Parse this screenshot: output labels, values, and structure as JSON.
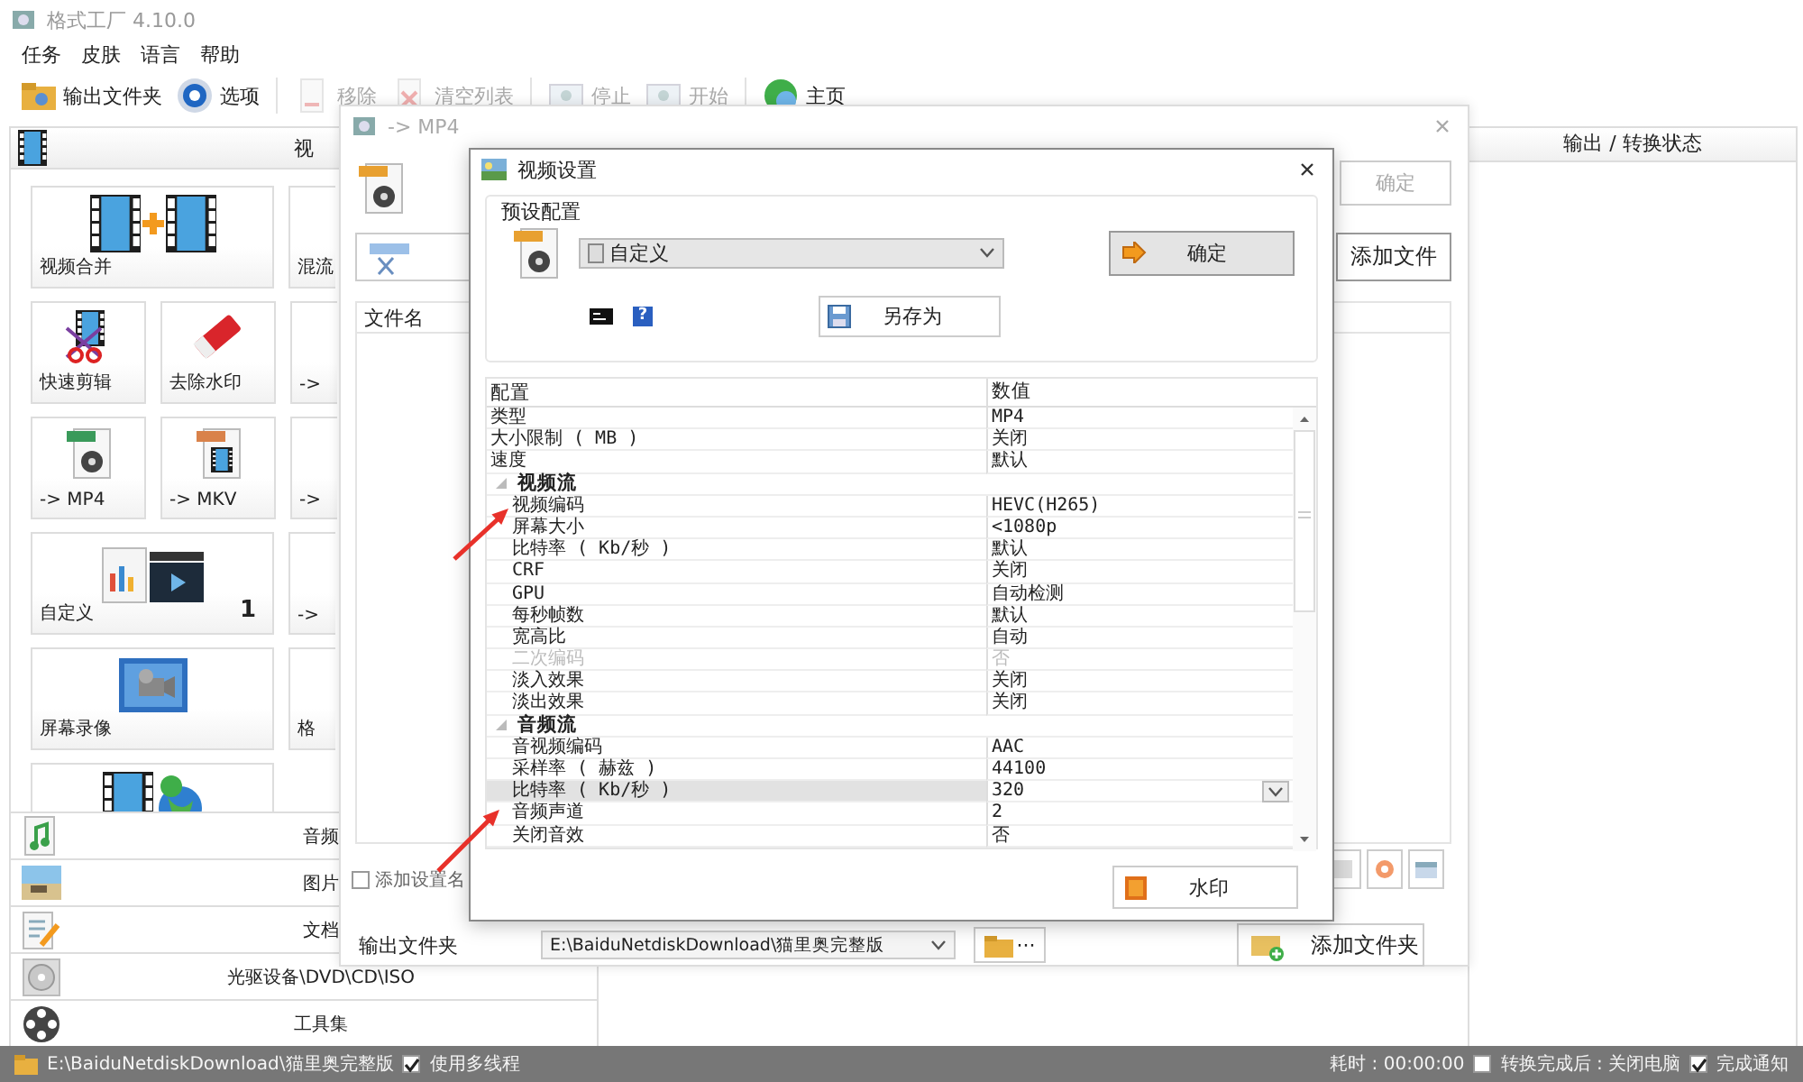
{
  "window": {
    "title": "格式工厂 4.10.0"
  },
  "menu": [
    "任务",
    "皮肤",
    "语言",
    "帮助"
  ],
  "toolbar": [
    {
      "label": "输出文件夹",
      "disabled": false
    },
    {
      "label": "选项",
      "disabled": false
    },
    {
      "label": "移除",
      "disabled": true
    },
    {
      "label": "清空列表",
      "disabled": true
    },
    {
      "label": "停止",
      "disabled": true
    },
    {
      "label": "开始",
      "disabled": true
    },
    {
      "label": "主页",
      "disabled": false
    }
  ],
  "sidebar": {
    "header": "视",
    "tiles": [
      {
        "kind": "wide",
        "label": "视频合并"
      },
      {
        "kind": "sliver",
        "label": "混流"
      },
      {
        "kind": "small",
        "label": "快速剪辑"
      },
      {
        "kind": "small",
        "label": "去除水印"
      },
      {
        "kind": "sliver",
        "label": "->"
      },
      {
        "kind": "small",
        "label": "-> MP4"
      },
      {
        "kind": "small",
        "label": "-> MKV"
      },
      {
        "kind": "sliver",
        "label": "->"
      },
      {
        "kind": "wide",
        "label": "自定义",
        "badge": "1"
      },
      {
        "kind": "sliver",
        "label": "->"
      },
      {
        "kind": "wide",
        "label": "屏幕录像"
      },
      {
        "kind": "sliver",
        "label": "格"
      },
      {
        "kind": "wide"
      }
    ],
    "categories": [
      "音频",
      "图片",
      "文档",
      "光驱设备\\DVD\\CD\\ISO",
      "工具集"
    ]
  },
  "output_panel": {
    "header": "输出 / 转换状态"
  },
  "convert_dialog": {
    "title": "-> MP4",
    "ok_button": "确定",
    "add_file_button": "添加文件",
    "list_columns": [
      "文件名"
    ],
    "add_setting_name": {
      "label": "添加设置名",
      "checked": false
    },
    "output_folder_label": "输出文件夹",
    "output_folder": "E:\\BaiduNetdiskDownload\\猫里奥完整版",
    "browse_button": "···",
    "add_folder_button": "添加文件夹"
  },
  "settings_dialog": {
    "title": "视频设置",
    "preset_group": "预设配置",
    "preset": "自定义",
    "ok_button": "确定",
    "help_button": "?",
    "save_as_button": "另存为",
    "grid": {
      "columns": [
        "配置",
        "数值"
      ],
      "rows": [
        {
          "kind": "row",
          "label": "类型",
          "value": "MP4",
          "disabled": false,
          "selected": false
        },
        {
          "kind": "row",
          "label": "大小限制 ( MB )",
          "value": "关闭",
          "disabled": false,
          "selected": false
        },
        {
          "kind": "row",
          "label": "速度",
          "value": "默认",
          "disabled": false,
          "selected": false
        },
        {
          "kind": "group",
          "label": "视频流",
          "expanded": true,
          "children": [
            {
              "kind": "row",
              "label": "视频编码",
              "value": "HEVC(H265)",
              "disabled": false,
              "selected": false
            },
            {
              "kind": "row",
              "label": "屏幕大小",
              "value": "<1080p",
              "disabled": false,
              "selected": false
            },
            {
              "kind": "row",
              "label": "比特率 ( Kb/秒 )",
              "value": "默认",
              "disabled": false,
              "selected": false
            },
            {
              "kind": "row",
              "label": "CRF",
              "value": "关闭",
              "disabled": false,
              "selected": false
            },
            {
              "kind": "row",
              "label": "GPU",
              "value": "自动检测",
              "disabled": false,
              "selected": false
            },
            {
              "kind": "row",
              "label": "每秒帧数",
              "value": "默认",
              "disabled": false,
              "selected": false
            },
            {
              "kind": "row",
              "label": "宽高比",
              "value": "自动",
              "disabled": false,
              "selected": false
            },
            {
              "kind": "row",
              "label": "二次编码",
              "value": "否",
              "disabled": true,
              "selected": false
            },
            {
              "kind": "row",
              "label": "淡入效果",
              "value": "关闭",
              "disabled": false,
              "selected": false
            },
            {
              "kind": "row",
              "label": "淡出效果",
              "value": "关闭",
              "disabled": false,
              "selected": false
            }
          ]
        },
        {
          "kind": "group",
          "label": "音频流",
          "expanded": true,
          "children": [
            {
              "kind": "row",
              "label": "音视频编码",
              "value": "AAC",
              "disabled": false,
              "selected": false
            },
            {
              "kind": "row",
              "label": "采样率 ( 赫兹 )",
              "value": "44100",
              "disabled": false,
              "selected": false
            },
            {
              "kind": "row",
              "label": "比特率 ( Kb/秒 )",
              "value": "320",
              "disabled": false,
              "selected": true
            },
            {
              "kind": "row",
              "label": "音频声道",
              "value": "2",
              "disabled": false,
              "selected": false
            },
            {
              "kind": "row",
              "label": "关闭音效",
              "value": "否",
              "disabled": false,
              "selected": false
            }
          ]
        }
      ]
    },
    "watermark_button": "水印"
  },
  "status_bar": {
    "path": "E:\\BaiduNetdiskDownload\\猫里奥完整版",
    "multithread": {
      "label": "使用多线程",
      "checked": true
    },
    "elapsed": "耗时 : 00:00:00",
    "shutdown": {
      "label": "转换完成后 : 关闭电脑",
      "checked": false
    },
    "notify": {
      "label": "完成通知",
      "checked": true
    }
  }
}
